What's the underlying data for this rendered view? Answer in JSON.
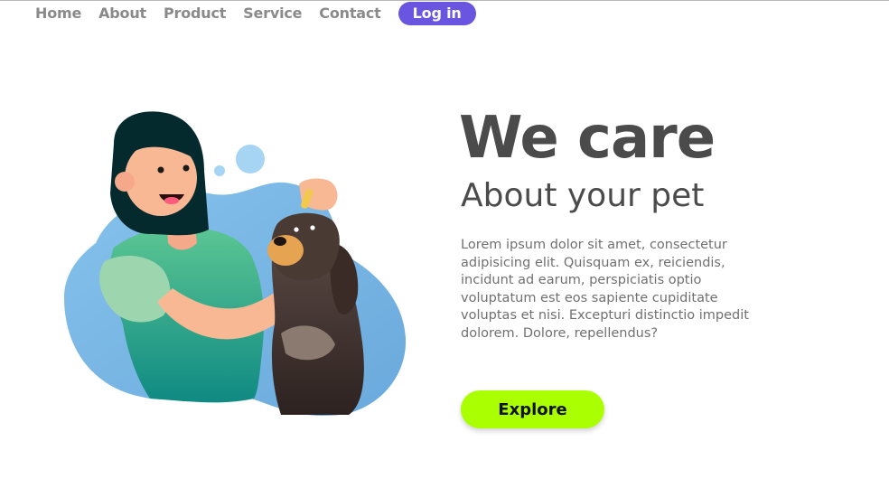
{
  "nav": {
    "items": [
      {
        "label": "Home"
      },
      {
        "label": "About"
      },
      {
        "label": "Product"
      },
      {
        "label": "Service"
      },
      {
        "label": "Contact"
      }
    ],
    "login_label": "Log in"
  },
  "hero": {
    "title": "We care",
    "subtitle": "About your pet",
    "body": "Lorem ipsum dolor sit amet, consectetur adipisicing elit. Quisquam ex, reiciendis, incidunt ad earum, perspiciatis optio voluptatum est eos sapiente cupiditate voluptas et nisi. Excepturi distinctio impedit dolorem. Dolore, repellendus?",
    "button_label": "Explore"
  },
  "illustration": {
    "icon": "woman-with-dog-illustration"
  },
  "colors": {
    "accent": "#6a55e0",
    "button": "#aaff00",
    "blob_blue": "#8ec7ee",
    "shirt_green": "#4cb88a",
    "dog_brown": "#4a3a34"
  }
}
